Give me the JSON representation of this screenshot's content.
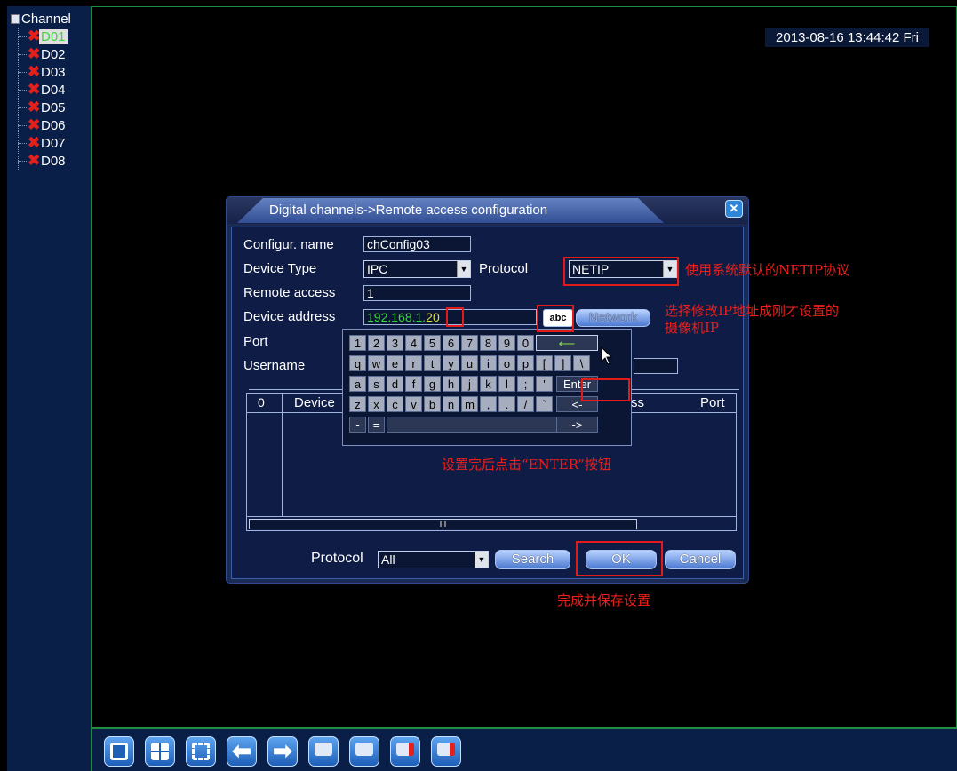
{
  "sidebar": {
    "root_label": "Channel",
    "channels": [
      "D01",
      "D02",
      "D03",
      "D04",
      "D05",
      "D06",
      "D07",
      "D08"
    ],
    "selected": "D01"
  },
  "datetime": "2013-08-16 13:44:42 Fri",
  "dialog": {
    "title": "Digital channels->Remote access configuration",
    "fields": {
      "config_name_label": "Configur. name",
      "config_name_value": "chConfig03",
      "device_type_label": "Device Type",
      "device_type_value": "IPC",
      "protocol_label": "Protocol",
      "protocol_value": "NETIP",
      "remote_access_label": "Remote access",
      "remote_access_value": "1",
      "device_address_label": "Device address",
      "device_address_value": "192.168.1.",
      "device_address_highlight": "20",
      "port_label": "Port",
      "username_label": "Username",
      "abc_label": "abc",
      "network_label": "Network"
    },
    "table": {
      "col_index": "0",
      "col_device": "Device",
      "col_address_partial": "ss",
      "col_port": "Port",
      "scroll_marker": "III"
    },
    "footer": {
      "protocol_label": "Protocol",
      "protocol_value": "All",
      "search_label": "Search",
      "ok_label": "OK",
      "cancel_label": "Cancel"
    }
  },
  "keyboard": {
    "row1": [
      "1",
      "2",
      "3",
      "4",
      "5",
      "6",
      "7",
      "8",
      "9",
      "0"
    ],
    "row2": [
      "q",
      "w",
      "e",
      "r",
      "t",
      "y",
      "u",
      "i",
      "o",
      "p",
      "[",
      "]",
      "\\"
    ],
    "row3": [
      "a",
      "s",
      "d",
      "f",
      "g",
      "h",
      "j",
      "k",
      "l",
      ";",
      "'"
    ],
    "row4": [
      "z",
      "x",
      "c",
      "v",
      "b",
      "n",
      "m",
      ",",
      ".",
      "/",
      "`"
    ],
    "row5": [
      "-",
      "="
    ],
    "backspace": "⟵",
    "enter": "Enter",
    "left": "<-",
    "right": "->"
  },
  "annotations": {
    "protocol_note": "使用系统默认的NETIP协议",
    "ip_note_line1": "选择修改IP地址成刚才设置的",
    "ip_note_line2": "摄像机IP",
    "enter_note": "设置完后点击“ENTER”按钮",
    "ok_note": "完成并保存设置"
  },
  "taskbar": {
    "icons": [
      "single-view-icon",
      "quad-view-icon",
      "fullscreen-icon",
      "previous-arrow-icon",
      "next-arrow-icon",
      "monitor-play-icon",
      "monitor-icon",
      "record-play-icon",
      "record-stop-icon"
    ]
  },
  "colors": {
    "annotation_red": "#e11a1a",
    "channel_error_red": "#e4201c",
    "selected_green": "#3ad93a",
    "panel_blue": "#1c2a56"
  }
}
